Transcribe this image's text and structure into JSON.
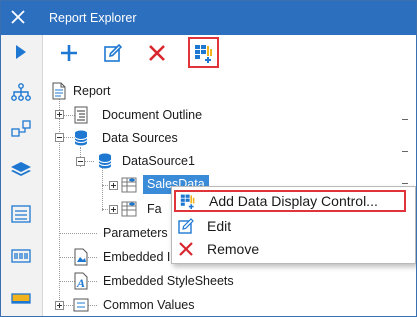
{
  "window": {
    "title": "Report Explorer"
  },
  "toolbar": {
    "buttons": [
      {
        "icon": "run-icon",
        "name": "run"
      },
      {
        "icon": "plus-icon",
        "name": "add"
      },
      {
        "icon": "edit-icon",
        "name": "edit"
      },
      {
        "icon": "delete-icon",
        "name": "delete"
      },
      {
        "icon": "add-data-display-control-icon",
        "name": "add-data-display-control",
        "highlighted": true
      }
    ]
  },
  "sidebar": {
    "items": [
      {
        "icon": "hierarchy-icon"
      },
      {
        "icon": "group-layout-icon"
      },
      {
        "icon": "layers-icon"
      },
      {
        "icon": "form-icon"
      },
      {
        "icon": "barcode-icon"
      },
      {
        "icon": "panel-icon"
      }
    ]
  },
  "tree": {
    "report": "Report",
    "document_outline": "Document Outline",
    "data_sources": "Data Sources",
    "datasource1": "DataSource1",
    "salesdata": "SalesData",
    "fa_partial": "Fa",
    "parameters": "Parameters",
    "embedded_images_partial": "Embedded Ima",
    "embedded_stylesheets": "Embedded StyleSheets",
    "common_values": "Common Values"
  },
  "context_menu": {
    "items": [
      {
        "label": "Add Data Display Control...",
        "icon": "add-data-display-control-icon",
        "highlighted": true
      },
      {
        "label": "Edit",
        "icon": "pencil-icon"
      },
      {
        "label": "Remove",
        "icon": "x-icon"
      }
    ]
  },
  "colors": {
    "titlebar": "#2d6fbf",
    "accent_blue": "#1e78d2",
    "delete_red": "#d9262c",
    "highlight_red": "#e0343a",
    "selection": "#3a8bd8"
  }
}
